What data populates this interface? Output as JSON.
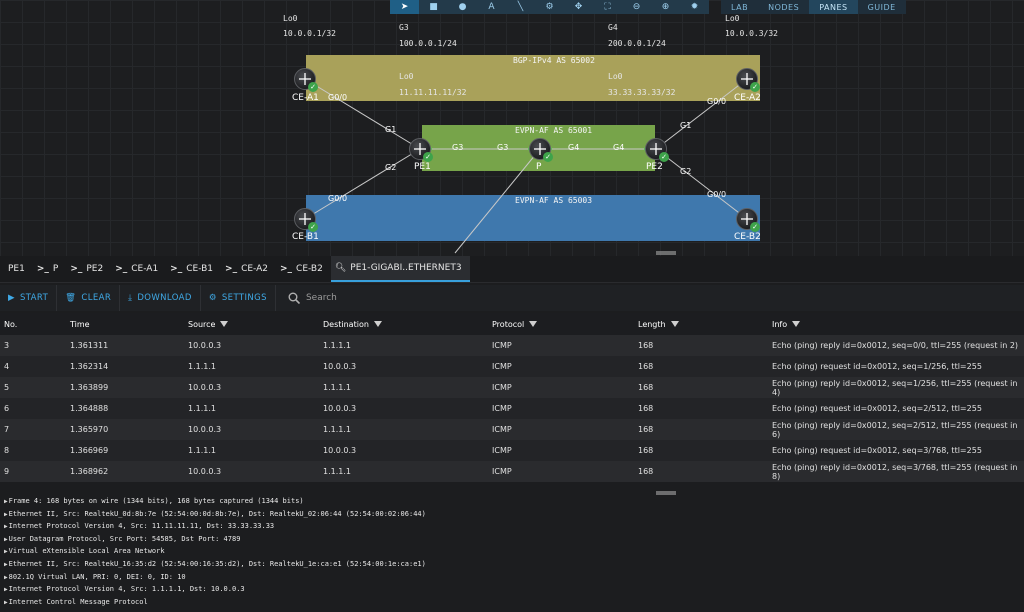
{
  "toolbar": {
    "tools": [
      "pointer-icon",
      "square-icon",
      "circle-icon",
      "text-icon",
      "line-icon",
      "topology-icon",
      "move-icon",
      "fit-icon",
      "zoom-out-icon",
      "zoom-in-icon",
      "settings-icon"
    ],
    "menus": [
      "LAB",
      "NODES",
      "PANES",
      "GUIDE"
    ]
  },
  "canvas": {
    "labels": {
      "lo0_a1": "Lo0",
      "lo0_a1_ip": "10.0.0.1/32",
      "g3": "G3",
      "g3_ip": "100.0.0.1/24",
      "g4": "G4",
      "g4_ip": "200.0.0.1/24",
      "lo0_a2": "Lo0",
      "lo0_a2_ip": "10.0.0.3/32",
      "lo0_pe1": "Lo0",
      "lo0_pe1_ip": "11.11.11.11/32",
      "lo0_pe2": "Lo0",
      "lo0_pe2_ip": "33.33.33.33/32"
    },
    "zones": {
      "bgp": "BGP-IPv4 AS 65002",
      "evpn1": "EVPN-AF AS 65001",
      "evpn3": "EVPN-AF AS 65003"
    },
    "nodes": {
      "ce_a1": "CE-A1",
      "ce_a2": "CE-A2",
      "pe1": "PE1",
      "p": "P",
      "pe2": "PE2",
      "ce_b1": "CE-B1",
      "ce_b2": "CE-B2"
    },
    "interfaces": {
      "a1_g00": "G0/0",
      "a1_g1": "G1",
      "a2_g00": "G0/0",
      "a2_g1": "G1",
      "pe1_g2": "G2",
      "pe1_g3": "G3",
      "p_g3": "G3",
      "p_g4": "G4",
      "pe2_g4": "G4",
      "pe2_g2": "G2",
      "b1_g00": "G0/0",
      "b2_g00": "G0/0"
    }
  },
  "tabs": [
    {
      "label": "PE1",
      "type": "console"
    },
    {
      "label": "P",
      "type": "console"
    },
    {
      "label": "PE2",
      "type": "console"
    },
    {
      "label": "CE-A1",
      "type": "console"
    },
    {
      "label": "CE-B1",
      "type": "console"
    },
    {
      "label": "CE-A2",
      "type": "console"
    },
    {
      "label": "CE-B2",
      "type": "console"
    },
    {
      "label": "PE1-GIGABI..ETHERNET3",
      "type": "capture",
      "active": true
    }
  ],
  "actions": {
    "start": "START",
    "clear": "CLEAR",
    "download": "DOWNLOAD",
    "settings": "SETTINGS",
    "search_placeholder": "Search"
  },
  "table": {
    "headers": [
      "No.",
      "Time",
      "Source",
      "Destination",
      "Protocol",
      "Length",
      "Info"
    ],
    "rows": [
      [
        "3",
        "1.361311",
        "10.0.0.3",
        "1.1.1.1",
        "ICMP",
        "168",
        "Echo (ping) reply id=0x0012, seq=0/0, ttl=255 (request in 2)"
      ],
      [
        "4",
        "1.362314",
        "1.1.1.1",
        "10.0.0.3",
        "ICMP",
        "168",
        "Echo (ping) request id=0x0012, seq=1/256, ttl=255"
      ],
      [
        "5",
        "1.363899",
        "10.0.0.3",
        "1.1.1.1",
        "ICMP",
        "168",
        "Echo (ping) reply id=0x0012, seq=1/256, ttl=255 (request in 4)"
      ],
      [
        "6",
        "1.364888",
        "1.1.1.1",
        "10.0.0.3",
        "ICMP",
        "168",
        "Echo (ping) request id=0x0012, seq=2/512, ttl=255"
      ],
      [
        "7",
        "1.365970",
        "10.0.0.3",
        "1.1.1.1",
        "ICMP",
        "168",
        "Echo (ping) reply id=0x0012, seq=2/512, ttl=255 (request in 6)"
      ],
      [
        "8",
        "1.366969",
        "1.1.1.1",
        "10.0.0.3",
        "ICMP",
        "168",
        "Echo (ping) request id=0x0012, seq=3/768, ttl=255"
      ],
      [
        "9",
        "1.368962",
        "10.0.0.3",
        "1.1.1.1",
        "ICMP",
        "168",
        "Echo (ping) reply id=0x0012, seq=3/768, ttl=255 (request in 8)"
      ]
    ]
  },
  "details": [
    "Frame 4: 168 bytes on wire (1344 bits), 168 bytes captured (1344 bits)",
    "Ethernet II, Src: RealtekU_0d:8b:7e (52:54:00:0d:8b:7e), Dst: RealtekU_02:06:44 (52:54:00:02:06:44)",
    "Internet Protocol Version 4, Src: 11.11.11.11, Dst: 33.33.33.33",
    "User Datagram Protocol, Src Port: 54585, Dst Port: 4789",
    "Virtual eXtensible Local Area Network",
    "Ethernet II, Src: RealtekU_16:35:d2 (52:54:00:16:35:d2), Dst: RealtekU_1e:ca:e1 (52:54:00:1e:ca:e1)",
    "802.1Q Virtual LAN, PRI: 0, DEI: 0, ID: 10",
    "Internet Protocol Version 4, Src: 1.1.1.1, Dst: 10.0.0.3",
    "Internet Control Message Protocol"
  ],
  "colors": {
    "bgp_zone": "#a9a15a",
    "evpn1_zone": "#77a44a",
    "evpn3_zone": "#3f78ad",
    "accent": "#3fa9e6",
    "link": "#5cb85c"
  }
}
